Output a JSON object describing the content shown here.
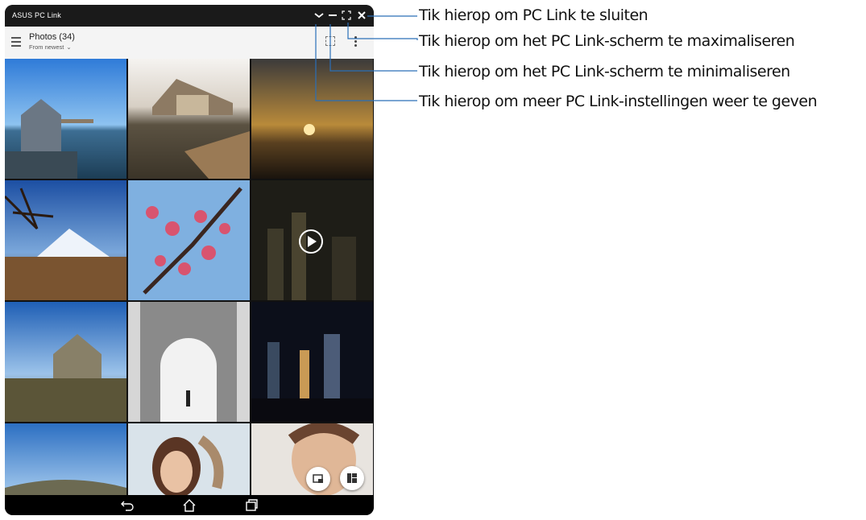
{
  "window": {
    "title": "ASUS PC Link"
  },
  "appbar": {
    "title": "Photos (34)",
    "sort_label": "From newest"
  },
  "callouts": [
    "Tik hierop om PC Link te sluiten",
    "Tik hierop om het PC Link-scherm te maximaliseren",
    "Tik hierop om het PC Link-scherm te minimaliseren",
    "Tik hierop om meer PC Link-instellingen weer te geven"
  ],
  "photos": [
    "pier-house",
    "castle-harbor",
    "sunset",
    "mount-fuji",
    "cherry-blossom",
    "city-night-video",
    "stone-church",
    "archway",
    "night-skyline",
    "coast-hill",
    "woman-portrait",
    "man-portrait"
  ],
  "icons": [
    "menu-icon",
    "chevron-down-icon",
    "select-icon",
    "more-options-icon",
    "settings-chevron-icon",
    "minimize-icon",
    "maximize-icon",
    "close-icon",
    "play-icon",
    "back-icon",
    "home-icon",
    "recents-icon",
    "slideshow-icon",
    "layout-icon"
  ],
  "colors": {
    "titlebar": "#1a1a1a",
    "appbar": "#f4f4f4",
    "callout_line": "#2a6fb8"
  }
}
